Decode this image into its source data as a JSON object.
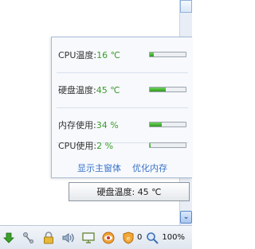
{
  "popup": {
    "rows": [
      {
        "label": "CPU温度:",
        "value": "16 ℃",
        "fill": 0.12
      },
      {
        "label": "硬盘温度:",
        "value": "45 ℃",
        "fill": 0.45
      },
      {
        "label": "内存使用:",
        "value": "34 %",
        "fill": 0.34
      },
      {
        "label": "CPU使用:",
        "value": "2 %",
        "fill": 0.02
      }
    ],
    "show_main_link": "显示主窗体",
    "optimize_link": "优化内存"
  },
  "tooltip": {
    "text": "硬盘温度: 45 ℃"
  },
  "taskbar": {
    "icons": [
      "green-download-arrow-icon",
      "network-icon",
      "lock-icon",
      "volume-icon",
      "monitor-icon",
      "eye-icon",
      "shield-icon",
      "magnifier-icon"
    ],
    "shield_count": "0",
    "zoom": "100%"
  },
  "colors": {
    "value_green": "#3d9a2f",
    "link_blue": "#3a72c8",
    "bar_fill": "#2f9a1d"
  }
}
